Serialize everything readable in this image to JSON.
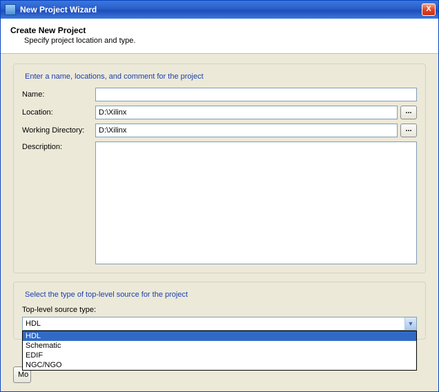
{
  "window": {
    "title": "New Project Wizard",
    "close_label": "X"
  },
  "header": {
    "title": "Create New Project",
    "subtitle": "Specify project location and type."
  },
  "group1": {
    "heading": "Enter a name, locations, and comment for the project",
    "name_label": "Name:",
    "name_value": "",
    "location_label": "Location:",
    "location_value": "D:\\Xilinx",
    "workdir_label": "Working Directory:",
    "workdir_value": "D:\\Xilinx",
    "desc_label": "Description:",
    "desc_value": "",
    "ellipsis": "..."
  },
  "group2": {
    "heading": "Select the type of top-level source for the project",
    "type_label": "Top-level source type:",
    "selected": "HDL",
    "options": [
      "HDL",
      "Schematic",
      "EDIF",
      "NGC/NGO"
    ]
  },
  "buttons": {
    "more_stub": "Mo"
  }
}
